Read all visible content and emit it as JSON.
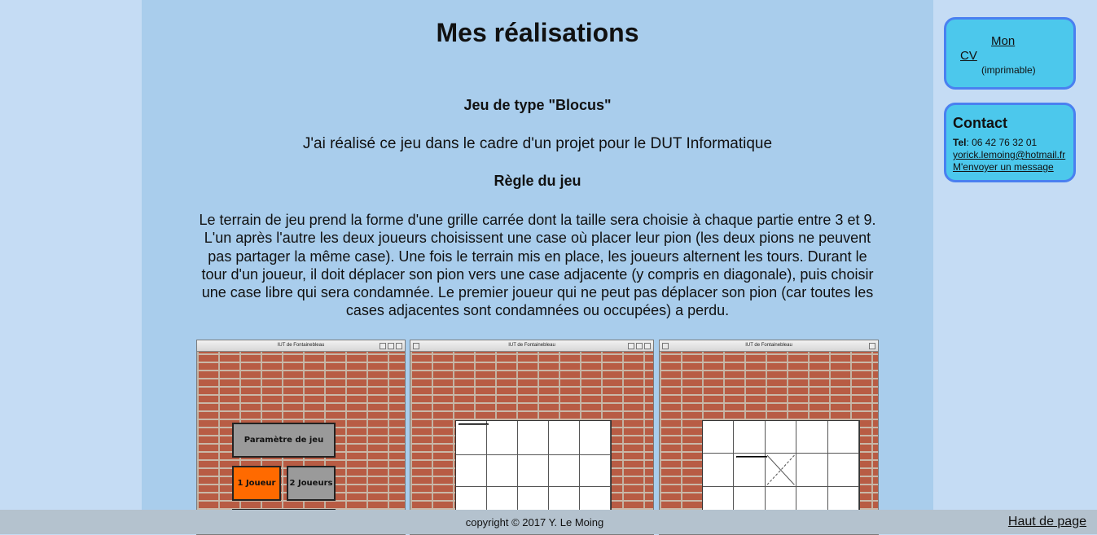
{
  "main": {
    "title": "Mes réalisations",
    "project_title": "Jeu de type \"Blocus\"",
    "intro": "J'ai réalisé ce jeu dans le cadre d'un projet pour le DUT Informatique",
    "rules_title": "Règle du jeu",
    "rules_text": "Le terrain de jeu prend la forme d'une grille carrée dont la taille sera choisie à chaque partie entre 3 et 9. L'un après l'autre les deux joueurs choisissent une case où placer leur pion (les deux pions ne peuvent pas partager la même case). Une fois le terrain mis en place, les joueurs alternent les tours. Durant le tour d'un joueur, il doit déplacer son pion vers une case adjacente (y compris en diagonale), puis choisir une case libre qui sera condamnée. Le premier joueur qui ne peut pas déplacer son pion (car toutes les cases adjacentes sont condamnées ou occupées) a perdu."
  },
  "screenshots": [
    {
      "window_title": "IUT de Fontainebleau",
      "settings_label": "Paramètre de jeu",
      "one_player_label": "1 Joueur",
      "two_players_label": "2 Joueurs"
    },
    {
      "window_title": "IUT de Fontainebleau"
    },
    {
      "window_title": "IUT de Fontainebleau"
    }
  ],
  "sidebar": {
    "cv_link_word1": "Mon",
    "cv_link_word2": "CV",
    "cv_note": "(imprimable)",
    "contact_title": "Contact",
    "tel_label": "Tel",
    "tel_value": ": 06 42 76 32 01",
    "email": "yorick.lemoing@hotmail.fr",
    "message_link": "M'envoyer un message"
  },
  "footer": {
    "copyright": "copyright © 2017 Y. Le Moing",
    "top_link": "Haut de page"
  },
  "colors": {
    "page_bg": "#c5dcf4",
    "main_bg": "#a9cdec",
    "sidebar_box": "#4cc8ec",
    "sidebar_border": "#4a80f0",
    "footer_bg": "#b4c2ce",
    "pawn": "#0000ff",
    "orange_button": "#ff6a00"
  }
}
